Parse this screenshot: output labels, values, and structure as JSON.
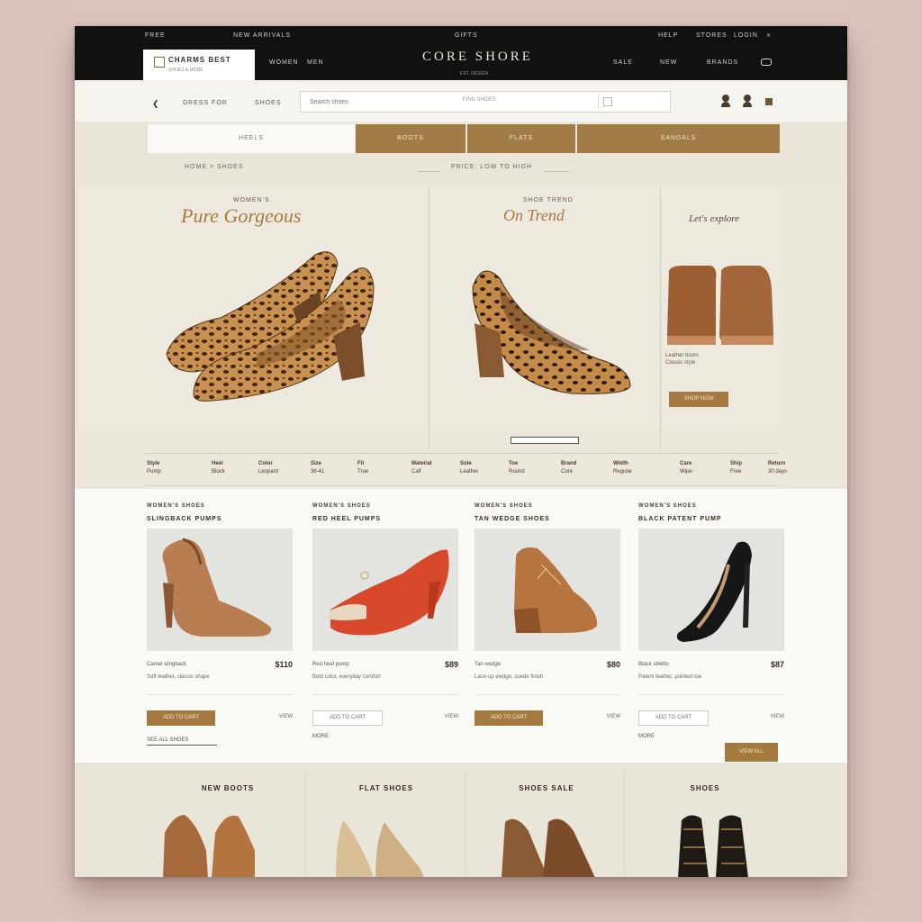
{
  "topbar": {
    "small_left": "FREE",
    "small_left2": "NEW ARRIVALS",
    "small_center": "GIFTS",
    "small_right": [
      "HELP",
      "STORES",
      "LOGIN"
    ],
    "logo_title": "CHARMS BEST",
    "logo_sub": "SHOES & MORE",
    "brand": "CORE SHORE",
    "brand_sub": "EST. DESIGN",
    "nav_left": [
      "WOMEN",
      "MEN"
    ],
    "nav_right": [
      "SALE",
      "NEW",
      "BRANDS"
    ]
  },
  "search": {
    "left_labels": [
      "DRESS FOR",
      "SHOES"
    ],
    "placeholder": "Search shoes",
    "hint": "FIND SHOES"
  },
  "categories": {
    "tabs": [
      "HEELS",
      "BOOTS",
      "FLATS",
      "SANDALS"
    ],
    "crumbs_left": "HOME > SHOES",
    "crumbs_right": "PRICE: LOW TO HIGH"
  },
  "hero": {
    "p1_small": "WOMEN'S",
    "p1_script": "Pure Gorgeous",
    "p2_small": "SHOE TREND",
    "p2_script": "On Trend",
    "p3_script": "Let's explore",
    "p3_text": [
      "Leather boots",
      "Classic style"
    ],
    "p3_button": "SHOP NOW",
    "features": [
      {
        "title": "Style",
        "value": "Pump"
      },
      {
        "title": "Heel",
        "value": "Block"
      },
      {
        "title": "Color",
        "value": "Leopard"
      },
      {
        "title": "Size",
        "value": "36-41"
      },
      {
        "title": "Fit",
        "value": "True"
      },
      {
        "title": "Material",
        "value": "Calf"
      },
      {
        "title": "Sole",
        "value": "Leather"
      },
      {
        "title": "Toe",
        "value": "Round"
      },
      {
        "title": "Brand",
        "value": "Core"
      },
      {
        "title": "Width",
        "value": "Regular"
      },
      {
        "title": "Care",
        "value": "Wipe"
      },
      {
        "title": "Ship",
        "value": "Free"
      },
      {
        "title": "Return",
        "value": "30 days"
      }
    ]
  },
  "products": [
    {
      "title": "WOMEN'S SHOES",
      "sub": "SLINGBACK PUMPS",
      "name": "Camel slingback",
      "price": "$110",
      "desc": "Soft leather, classic shape",
      "button": "ADD TO CART",
      "tag": "VIEW",
      "button_style": "solid"
    },
    {
      "title": "WOMEN'S SHOES",
      "sub": "RED HEEL PUMPS",
      "name": "Red heel pump",
      "price": "$89",
      "desc": "Bold color, everyday comfort",
      "button": "ADD TO CART",
      "tag": "VIEW",
      "button_style": "outline"
    },
    {
      "title": "WOMEN'S SHOES",
      "sub": "TAN WEDGE SHOES",
      "name": "Tan wedge",
      "price": "$80",
      "desc": "Lace-up wedge, suede finish",
      "button": "ADD TO CART",
      "tag": "VIEW",
      "button_style": "solid"
    },
    {
      "title": "WOMEN'S SHOES",
      "sub": "BLACK PATENT PUMP",
      "name": "Black stiletto",
      "price": "$87",
      "desc": "Patent leather, pointed toe",
      "button": "ADD TO CART",
      "tag": "VIEW",
      "button_style": "outline"
    }
  ],
  "more": {
    "link": "SEE ALL SHOES",
    "small_left": "MORE",
    "small_right": "MORE",
    "view_all": "VIEW ALL"
  },
  "bottom": {
    "labels": [
      "NEW BOOTS",
      "FLAT SHOES",
      "SHOES SALE",
      "SHOES"
    ]
  },
  "colors": {
    "accent": "#a57a40",
    "topbar": "#111111",
    "background": "#f4f1ea"
  },
  "icons": {
    "back": "chevron-left-icon",
    "user": "user-icon",
    "bag": "bag-icon",
    "cart": "cart-icon",
    "camera": "camera-icon"
  }
}
